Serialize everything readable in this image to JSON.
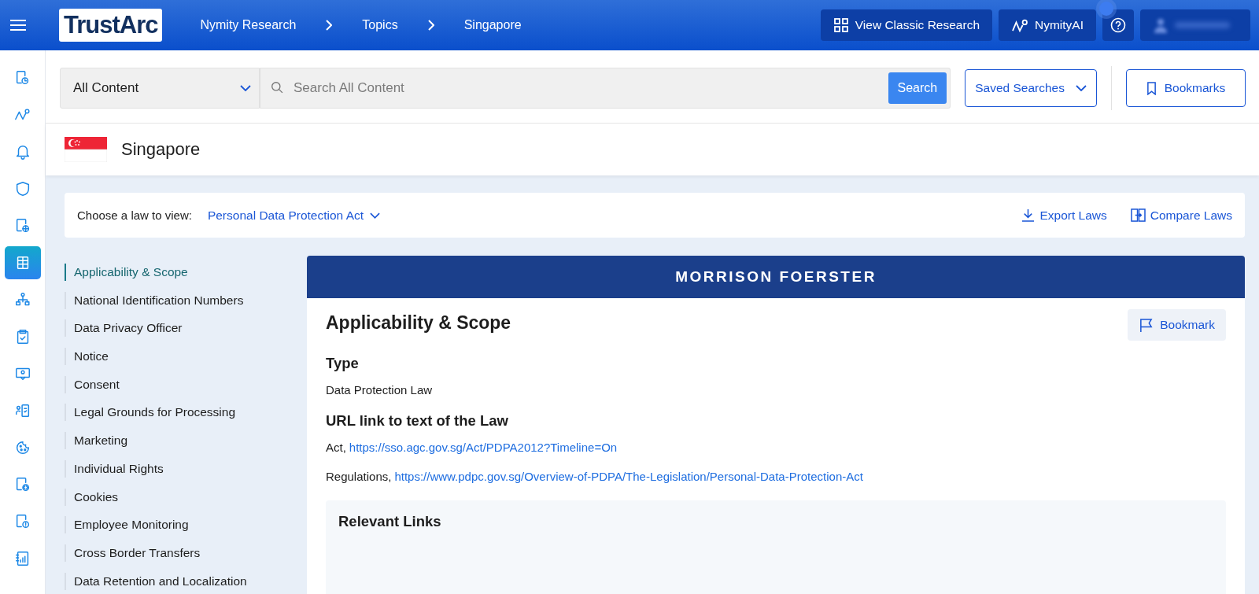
{
  "header": {
    "logo": "TrustArc",
    "breadcrumbs": [
      "Nymity Research",
      "Topics",
      "Singapore"
    ],
    "classic_button": "View Classic Research",
    "ai_button": "NymityAI"
  },
  "sidebar": {
    "items": [
      {
        "selected": false
      },
      {
        "selected": false
      },
      {
        "selected": false
      },
      {
        "selected": false
      },
      {
        "selected": false
      },
      {
        "selected": true
      },
      {
        "selected": false
      },
      {
        "selected": false
      },
      {
        "selected": false
      },
      {
        "selected": false
      },
      {
        "selected": false
      },
      {
        "selected": false
      },
      {
        "selected": false
      },
      {
        "selected": false
      }
    ]
  },
  "search": {
    "scope": "All Content",
    "placeholder": "Search All Content",
    "button": "Search",
    "saved_searches": "Saved Searches",
    "bookmarks": "Bookmarks"
  },
  "country": {
    "name": "Singapore"
  },
  "law_bar": {
    "label": "Choose a law to view:",
    "law": "Personal Data Protection Act",
    "export": "Export Laws",
    "compare": "Compare Laws"
  },
  "topics": [
    {
      "label": "Applicability & Scope",
      "selected": true
    },
    {
      "label": "National Identification Numbers",
      "selected": false
    },
    {
      "label": "Data Privacy Officer",
      "selected": false
    },
    {
      "label": "Notice",
      "selected": false
    },
    {
      "label": "Consent",
      "selected": false
    },
    {
      "label": "Legal Grounds for Processing",
      "selected": false
    },
    {
      "label": "Marketing",
      "selected": false
    },
    {
      "label": "Individual Rights",
      "selected": false
    },
    {
      "label": "Cookies",
      "selected": false
    },
    {
      "label": "Employee Monitoring",
      "selected": false
    },
    {
      "label": "Cross Border Transfers",
      "selected": false
    },
    {
      "label": "Data Retention and Localization",
      "selected": false
    }
  ],
  "article": {
    "banner": "MORRISON FOERSTER",
    "title": "Applicability & Scope",
    "bookmark": "Bookmark",
    "sections": [
      {
        "heading": "Type",
        "lines": [
          {
            "prefix": "Data Protection Law"
          }
        ]
      },
      {
        "heading": "URL link to text of the Law",
        "lines": [
          {
            "prefix": "Act,",
            "link": "https://sso.agc.gov.sg/Act/PDPA2012?Timeline=On"
          },
          {
            "prefix": "Regulations,",
            "link": "https://www.pdpc.gov.sg/Overview-of-PDPA/The-Legislation/Personal-Data-Protection-Act"
          }
        ]
      }
    ],
    "relevant_links": "Relevant Links"
  }
}
